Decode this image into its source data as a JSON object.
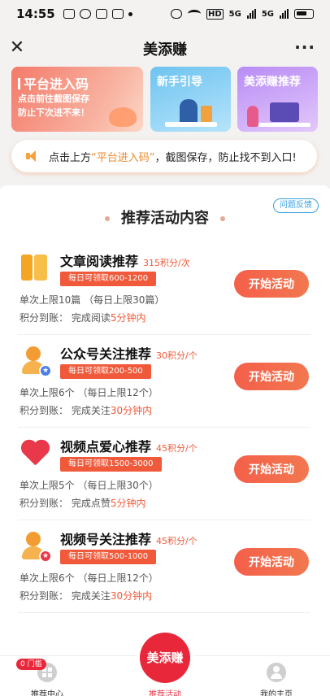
{
  "status_bar": {
    "time": "14:55",
    "network_label": "HD",
    "signal_label": "5G"
  },
  "nav": {
    "title": "美添赚",
    "more": "···"
  },
  "banners": [
    {
      "title": "平台进入码",
      "line1": "点击前往截图保存",
      "line2": "防止下次进不来！"
    },
    {
      "title": "新手引导"
    },
    {
      "title": "美添赚推荐"
    }
  ],
  "notice": {
    "before": "点击上方",
    "highlight": "“平台进入码”",
    "after": "，截图保存，防止找不到入口!"
  },
  "feedback_label": "问题反馈",
  "section_title": "推荐活动内容",
  "tasks": [
    {
      "icon": "book-icon",
      "name": "文章阅读推荐",
      "points": "315积分/次",
      "badge": "每日可领取600-1200",
      "limit": "单次上限10篇 （每日上限30篇）",
      "settle_prefix": "积分到账： 完成阅读",
      "settle_time": "5分钟内",
      "button": "开始活动"
    },
    {
      "icon": "user-star-icon",
      "name": "公众号关注推荐",
      "points": "30积分/个",
      "badge": "每日可领取200-500",
      "limit": "单次上限6个 （每日上限12个）",
      "settle_prefix": "积分到账： 完成关注",
      "settle_time": "30分钟内",
      "button": "开始活动"
    },
    {
      "icon": "heart-icon",
      "name": "视频点爱心推荐",
      "points": "45积分/个",
      "badge": "每日可领取1500-3000",
      "limit": "单次上限5个 （每日上限30个）",
      "settle_prefix": "积分到账： 完成点赞",
      "settle_time": "5分钟内",
      "button": "开始活动"
    },
    {
      "icon": "user-star-red-icon",
      "name": "视频号关注推荐",
      "points": "45积分/个",
      "badge": "每日可领取500-1000",
      "limit": "单次上限6个 （每日上限12个）",
      "settle_prefix": "积分到账： 完成关注",
      "settle_time": "30分钟内",
      "button": "开始活动"
    }
  ],
  "tabbar": {
    "home_badge": "0 门槛",
    "home": "推荐中心",
    "center_logo": "美添赚",
    "activity": "推荐活动",
    "me": "我的主页"
  },
  "colors": {
    "accent": "#f05a3a",
    "brand_red": "#e8283a",
    "highlight_orange": "#f08a2c",
    "link_blue": "#3aa0e0"
  }
}
